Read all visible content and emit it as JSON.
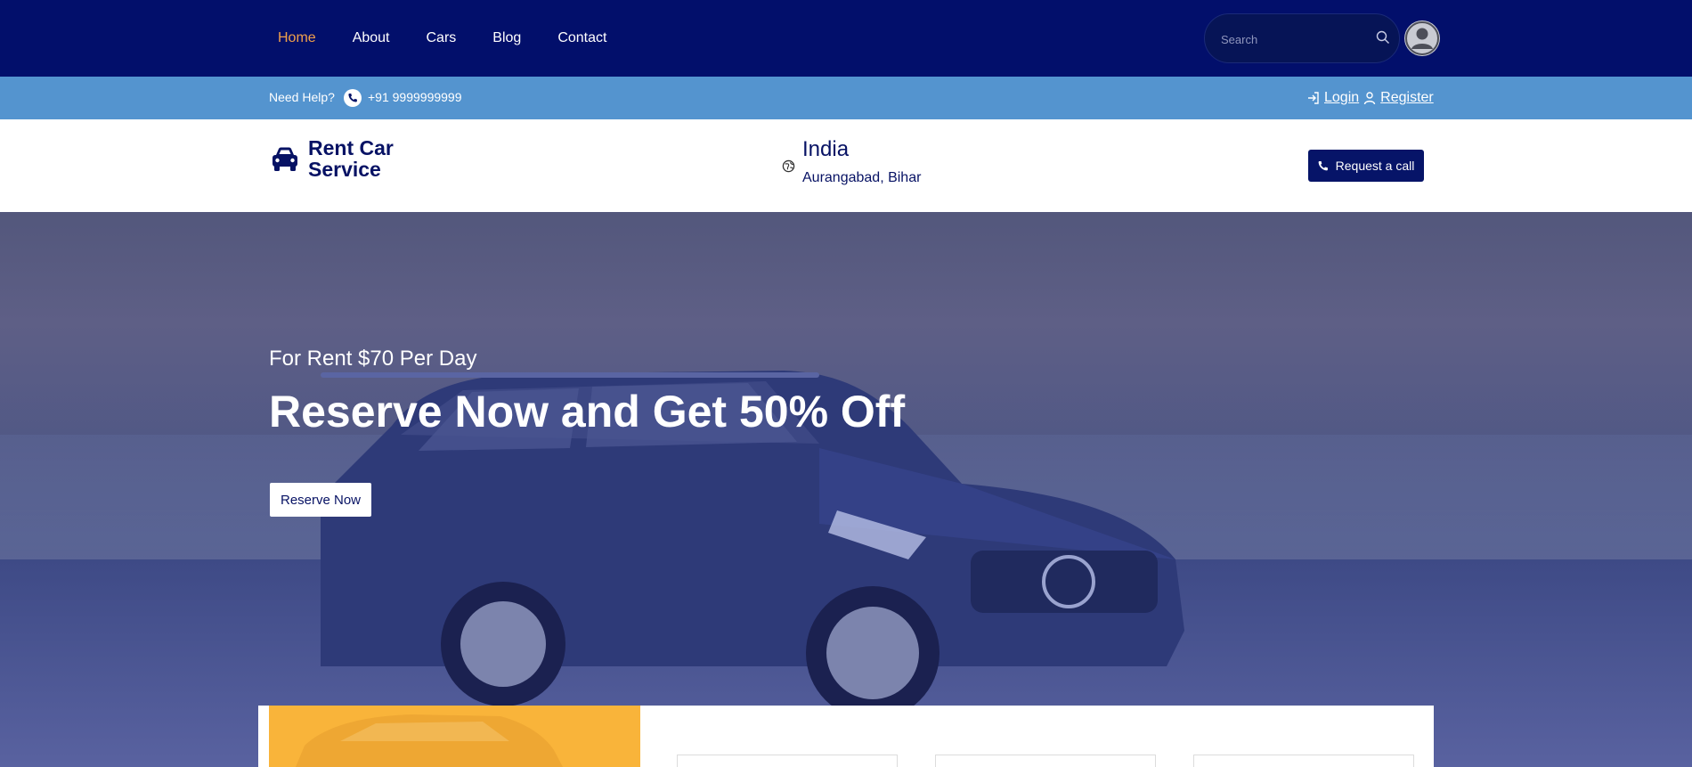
{
  "nav": {
    "links": [
      "Home",
      "About",
      "Cars",
      "Blog",
      "Contact"
    ],
    "active": "Home",
    "search_placeholder": "Search",
    "active_color": "#f0a04b",
    "bg_color": "#020f6b"
  },
  "helpbar": {
    "help_text": "Need Help?",
    "phone": "+91 9999999999",
    "login": "Login",
    "register": "Register",
    "bg_color": "#5494cf"
  },
  "brand": {
    "name": "Rent Car Service",
    "country": "India",
    "city": "Aurangabad, Bihar",
    "request_label": "Request a call",
    "color": "#071264"
  },
  "hero": {
    "subtitle": "For Rent $70 Per Day",
    "title": "Reserve Now and Get 50% Off",
    "button_label": "Reserve Now"
  },
  "booking": {
    "accent_color": "#f9b43a"
  }
}
